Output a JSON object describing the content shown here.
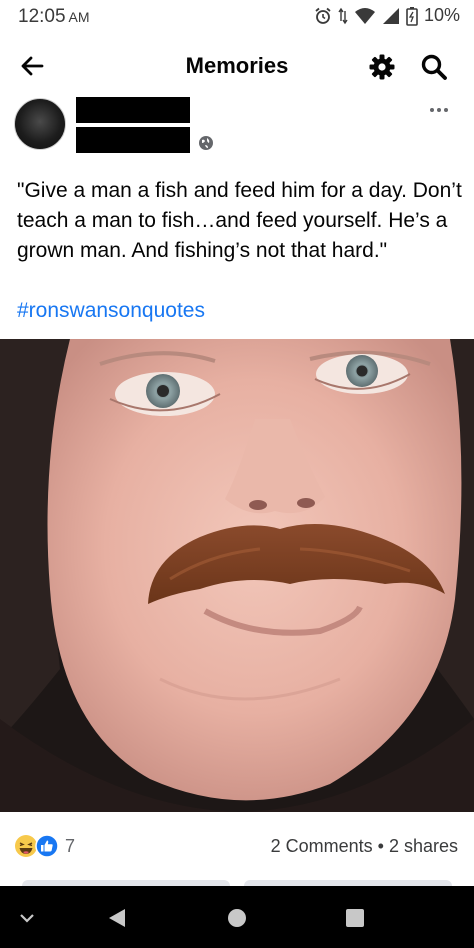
{
  "status_bar": {
    "time": "12:05",
    "ampm": "AM",
    "battery_percent": "10%",
    "icons": [
      "alarm-icon",
      "data-arrows-icon",
      "wifi-icon",
      "signal-icon",
      "battery-icon"
    ]
  },
  "header": {
    "title": "Memories",
    "back_icon": "back-arrow-icon",
    "settings_icon": "gear-icon",
    "search_icon": "search-icon"
  },
  "post": {
    "privacy_icon": "globe-icon",
    "more_icon": "more-dots-icon",
    "text": "\"Give a man a fish and feed him for a day. Don’t teach a man to fish…and feed yourself. He’s a grown man. And fishing’s not that hard.\"",
    "hashtag": "#ronswansonquotes",
    "reaction_icons": [
      "haha-reaction-icon",
      "like-reaction-icon"
    ],
    "reaction_count": "7",
    "engagement": "2 Comments • 2 shares"
  },
  "colors": {
    "link": "#1877f2",
    "text": "#050505",
    "secondary": "#65676b",
    "like_blue": "#1877f2",
    "haha_yellow": "#f7c94b"
  }
}
